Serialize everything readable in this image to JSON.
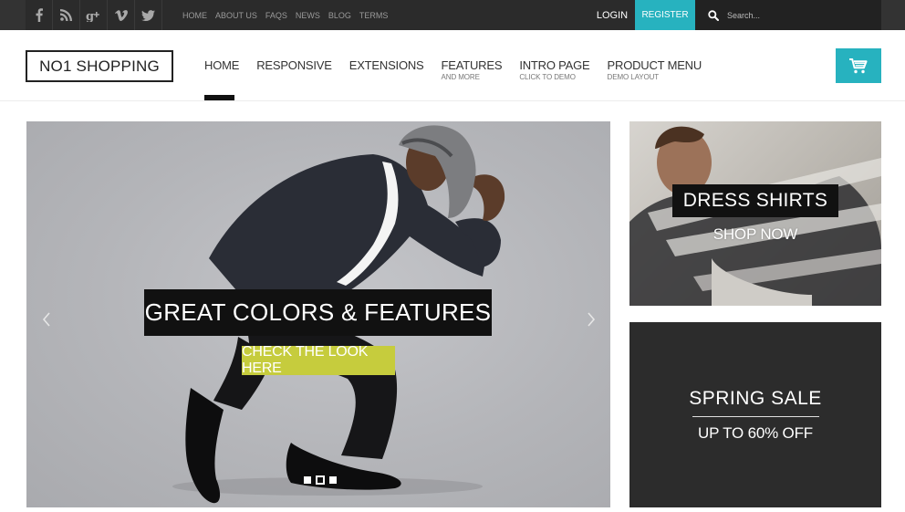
{
  "topbar": {
    "social": [
      {
        "icon": "facebook-icon",
        "glyph": "f"
      },
      {
        "icon": "rss-icon",
        "glyph": "rss"
      },
      {
        "icon": "google-plus-icon",
        "glyph": "g+"
      },
      {
        "icon": "vimeo-icon",
        "glyph": "v"
      },
      {
        "icon": "twitter-icon",
        "glyph": "tw"
      }
    ],
    "links": [
      "HOME",
      "ABOUT US",
      "FAQS",
      "NEWS",
      "BLOG",
      "TERMS"
    ],
    "login_label": "LOGIN",
    "register_label": "REGISTER",
    "search_placeholder": "Search..."
  },
  "header": {
    "logo_text": "NO1 SHOPPING",
    "nav": [
      {
        "label": "HOME",
        "sub": "",
        "active": true
      },
      {
        "label": "RESPONSIVE",
        "sub": ""
      },
      {
        "label": "EXTENSIONS",
        "sub": ""
      },
      {
        "label": "FEATURES",
        "sub": "AND MORE"
      },
      {
        "label": "INTRO PAGE",
        "sub": "CLICK TO DEMO"
      },
      {
        "label": "PRODUCT MENU",
        "sub": "DEMO LAYOUT"
      }
    ],
    "cart_icon": "shopping-cart-icon"
  },
  "hero": {
    "title": "GREAT COLORS & FEATURES",
    "cta": "CHECK THE LOOK HERE",
    "slide_count": 3,
    "active_slide": 2
  },
  "banners": {
    "top": {
      "title": "DRESS SHIRTS",
      "cta": "SHOP NOW"
    },
    "bottom": {
      "title": "SPRING SALE",
      "subtitle": "UP TO 60% OFF"
    }
  },
  "colors": {
    "accent": "#27b2bf",
    "cta_green": "#c6cc3d",
    "topbar": "#2b2b2b",
    "dark_panel": "#2c2c2c"
  }
}
